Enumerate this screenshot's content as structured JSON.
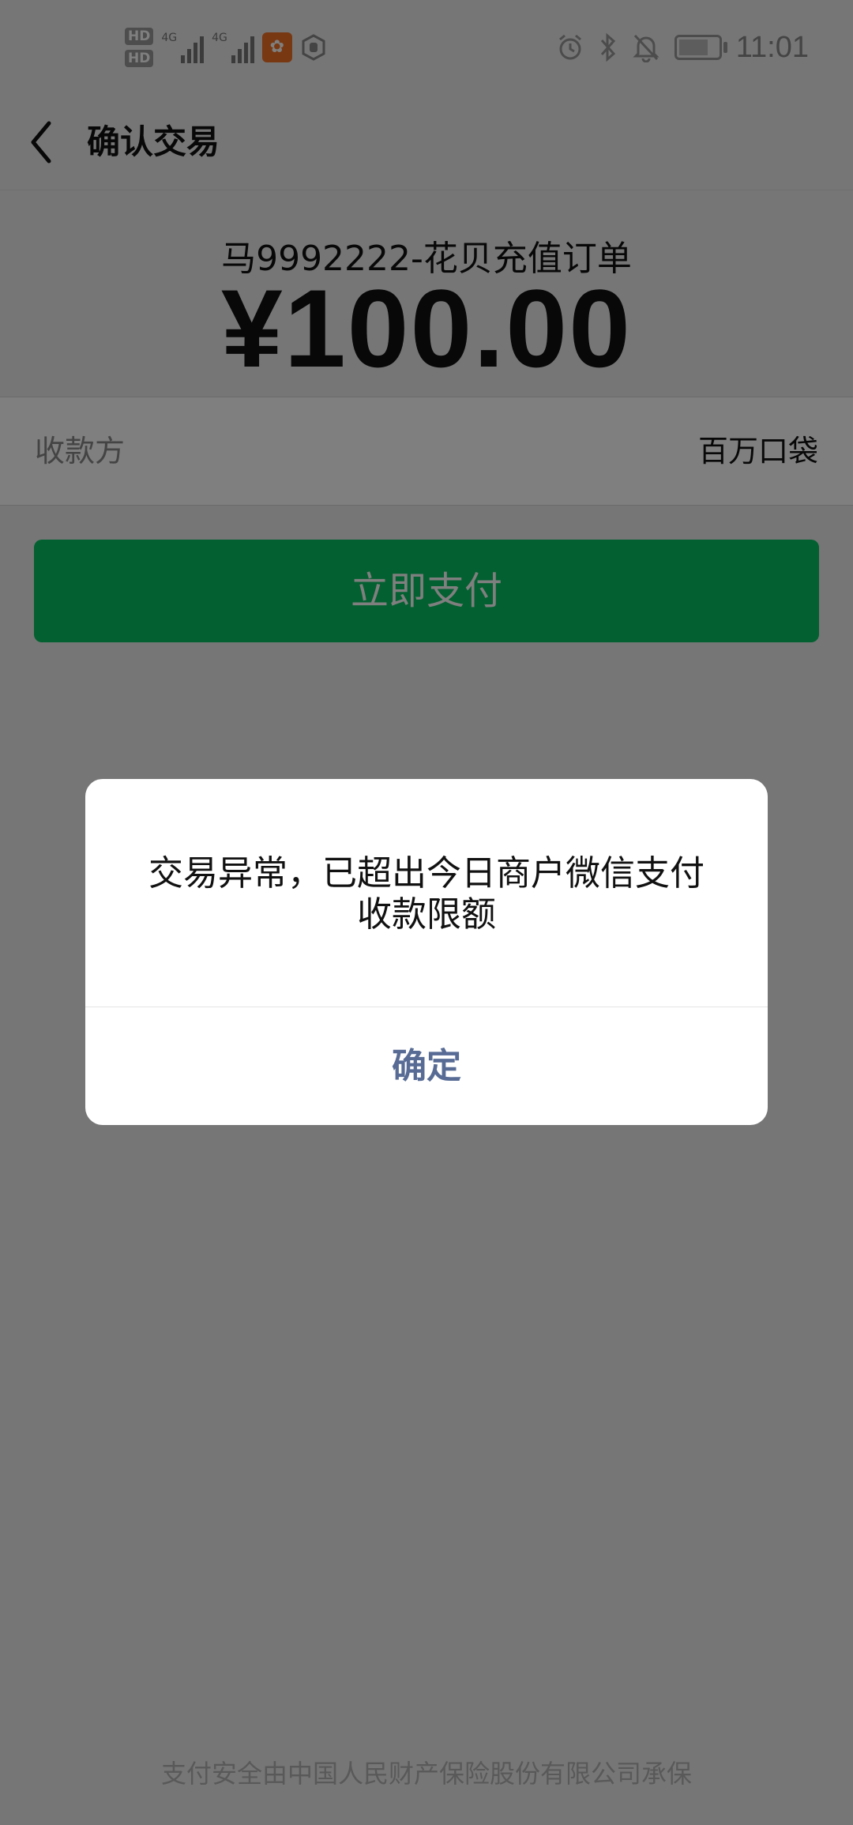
{
  "status_bar": {
    "time": "11:01",
    "sim1_label": "HD",
    "sim2_label": "HD",
    "network1": "4G",
    "network2": "4G",
    "app_badge_icon": "app-notification-icon",
    "icons": [
      "alarm-icon",
      "bluetooth-icon",
      "mute-icon",
      "battery-icon"
    ]
  },
  "nav": {
    "title": "确认交易",
    "back_icon": "chevron-left-icon"
  },
  "order": {
    "name": "马9992222-花贝充值订单",
    "amount": "¥100.00"
  },
  "payee": {
    "label": "收款方",
    "value": "百万口袋"
  },
  "pay_button": {
    "label": "立即支付"
  },
  "dialog": {
    "message": "交易异常，已超出今日商户微信支付收款限额",
    "confirm_label": "确定"
  },
  "footer": {
    "note": "支付安全由中国人民财产保险股份有限公司承保"
  },
  "colors": {
    "accent": "#07c160",
    "dialog_action": "#576b95",
    "background": "#ededed"
  }
}
